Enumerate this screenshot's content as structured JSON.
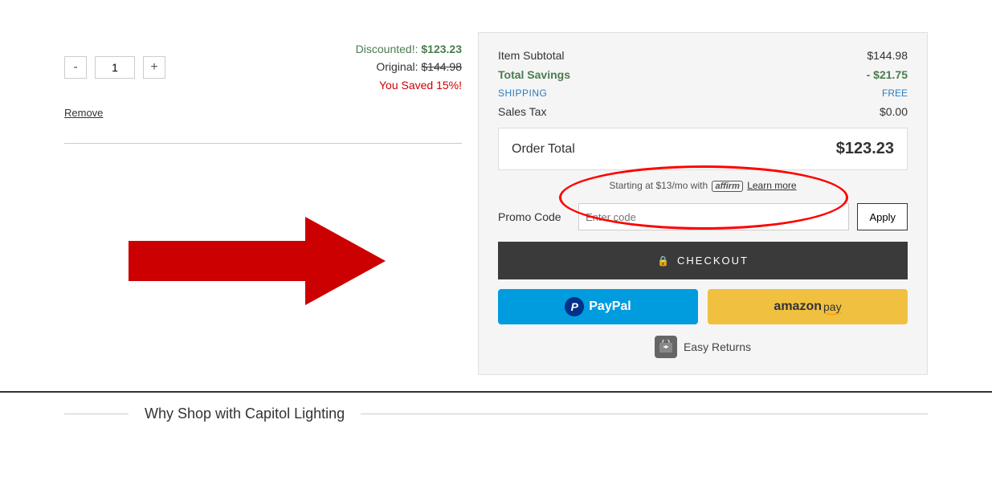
{
  "quantity": {
    "value": "1",
    "minus_label": "-",
    "plus_label": "+"
  },
  "pricing": {
    "discounted_label": "Discounted!:",
    "discounted_value": "$123.23",
    "original_label": "Original:",
    "original_value": "$144.98",
    "saved_label": "You Saved 15%!"
  },
  "remove_link": "Remove",
  "summary": {
    "item_subtotal_label": "Item Subtotal",
    "item_subtotal_value": "$144.98",
    "total_savings_label": "Total Savings",
    "total_savings_value": "- $21.75",
    "shipping_label": "SHIPPING",
    "shipping_value": "FREE",
    "sales_tax_label": "Sales Tax",
    "sales_tax_value": "$0.00",
    "order_total_label": "Order Total",
    "order_total_value": "$123.23"
  },
  "affirm": {
    "text_before": "Starting at $13/mo with",
    "logo_text": "affirm",
    "learn_more": "Learn more"
  },
  "promo": {
    "label": "Promo Code",
    "placeholder": "Enter code",
    "apply_label": "Apply"
  },
  "checkout": {
    "label": "CHECKOUT",
    "lock_icon": "🔒"
  },
  "paypal": {
    "p_icon": "P",
    "label": "PayPal"
  },
  "amazon": {
    "label": "amazon pay"
  },
  "easy_returns": {
    "label": "Easy Returns",
    "icon": "📦"
  },
  "bottom": {
    "title": "Why Shop with Capitol Lighting"
  }
}
